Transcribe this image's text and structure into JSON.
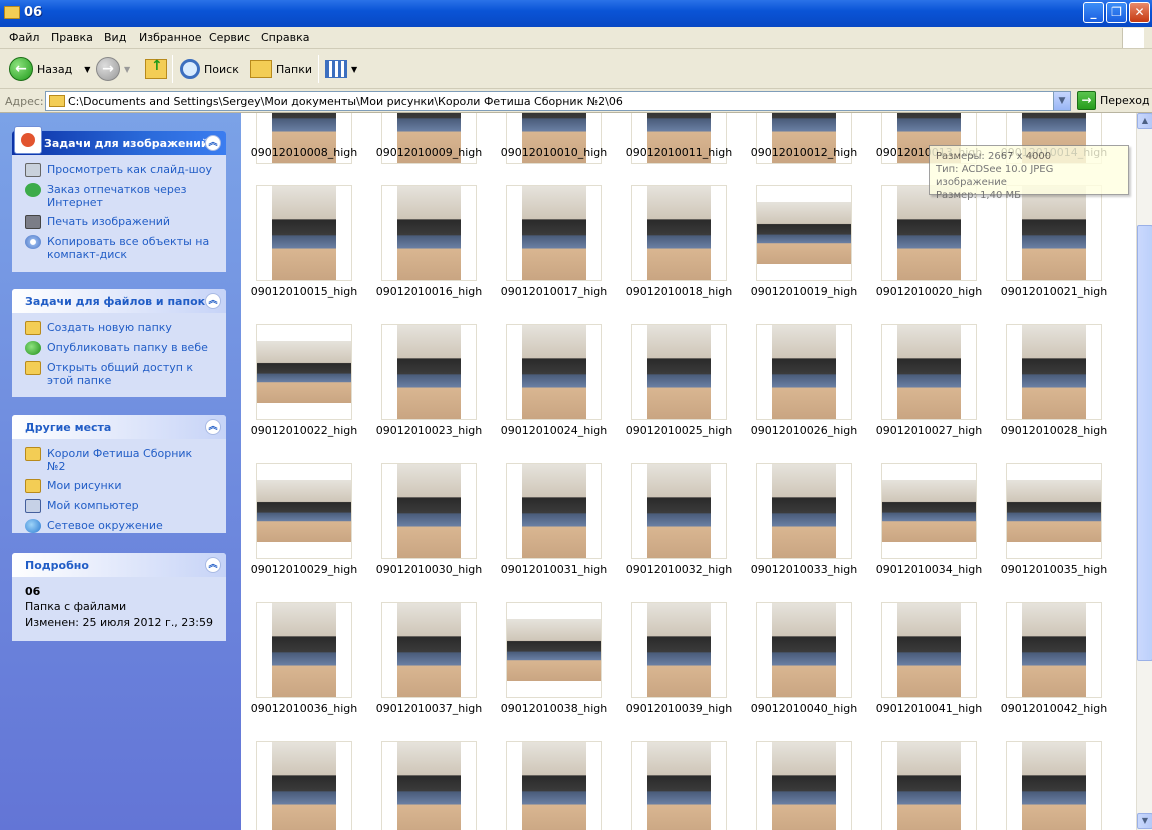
{
  "window": {
    "title": "06"
  },
  "menu": [
    "Файл",
    "Правка",
    "Вид",
    "Избранное",
    "Сервис",
    "Справка"
  ],
  "toolbar": {
    "back": "Назад",
    "search": "Поиск",
    "folders": "Папки"
  },
  "address": {
    "label": "Адрес:",
    "path": "C:\\Documents and Settings\\Sergey\\Мои документы\\Мои рисунки\\Короли Фетиша Сборник №2\\06",
    "go": "Переход"
  },
  "sidebar": {
    "image_tasks": {
      "title": "Задачи для изображений",
      "items": [
        {
          "label": "Просмотреть как слайд-шоу",
          "icon": "slideshow-icon"
        },
        {
          "label": "Заказ отпечатков через Интернет",
          "icon": "order-prints-icon"
        },
        {
          "label": "Печать изображений",
          "icon": "printer-icon"
        },
        {
          "label": "Копировать все объекты на компакт-диск",
          "icon": "cd-icon"
        }
      ]
    },
    "file_tasks": {
      "title": "Задачи для файлов и папок",
      "items": [
        {
          "label": "Создать новую папку",
          "icon": "new-folder-icon"
        },
        {
          "label": "Опубликовать папку в вебе",
          "icon": "publish-web-icon"
        },
        {
          "label": "Открыть общий доступ к этой папке",
          "icon": "share-folder-icon"
        }
      ]
    },
    "other_places": {
      "title": "Другие места",
      "items": [
        {
          "label": "Короли Фетиша Сборник №2",
          "icon": "folder-icon"
        },
        {
          "label": "Мои рисунки",
          "icon": "my-pictures-icon"
        },
        {
          "label": "Мой компьютер",
          "icon": "my-computer-icon"
        },
        {
          "label": "Сетевое окружение",
          "icon": "network-icon"
        }
      ]
    },
    "details": {
      "title": "Подробно",
      "name": "06",
      "type": "Папка с файлами",
      "modified": "Изменен: 25 июля 2012 г., 23:59"
    }
  },
  "thumbnails": [
    [
      "09012010008_high",
      "09012010009_high",
      "09012010010_high",
      "09012010011_high",
      "09012010012_high",
      "09012010013_high",
      "09012010014_high"
    ],
    [
      "09012010015_high",
      "09012010016_high",
      "09012010017_high",
      "09012010018_high",
      "09012010019_high",
      "09012010020_high",
      "09012010021_high"
    ],
    [
      "09012010022_high",
      "09012010023_high",
      "09012010024_high",
      "09012010025_high",
      "09012010026_high",
      "09012010027_high",
      "09012010028_high"
    ],
    [
      "09012010029_high",
      "09012010030_high",
      "09012010031_high",
      "09012010032_high",
      "09012010033_high",
      "09012010034_high",
      "09012010035_high"
    ],
    [
      "09012010036_high",
      "09012010037_high",
      "09012010038_high",
      "09012010039_high",
      "09012010040_high",
      "09012010041_high",
      "09012010042_high"
    ],
    [
      "",
      "",
      "",
      "",
      "",
      "",
      ""
    ]
  ],
  "tooltip": {
    "line1": "Размеры: 2667 x 4000",
    "line2": "Тип: ACDSee 10.0 JPEG изображение",
    "line3": "Размер: 1,40 МБ"
  },
  "colors": {
    "titlebar": "#0a54d6",
    "sidebar": "#6f8ee0",
    "link": "#215dc6"
  }
}
